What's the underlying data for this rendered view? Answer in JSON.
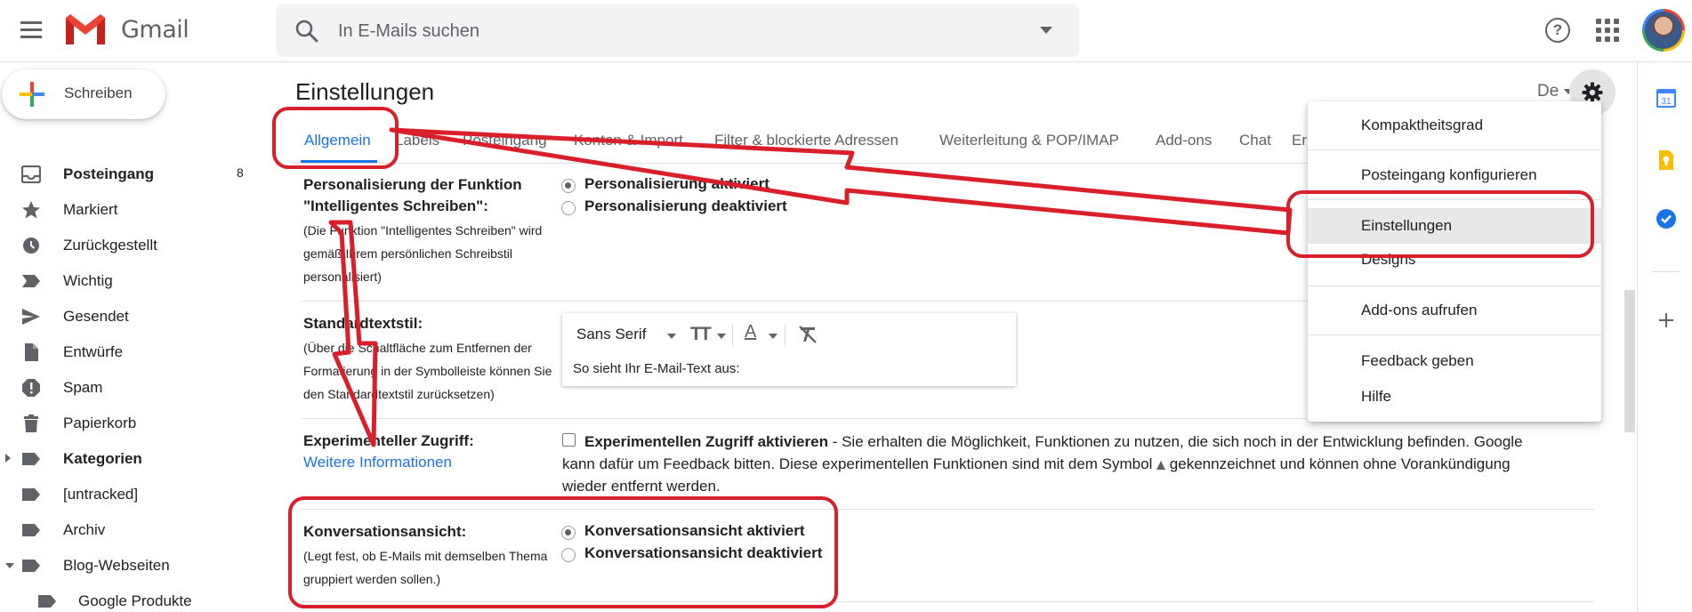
{
  "header": {
    "app_name": "Gmail",
    "search_placeholder": "In E-Mails suchen"
  },
  "sidebar": {
    "compose_label": "Schreiben",
    "items": [
      {
        "label": "Posteingang",
        "count": "8",
        "icon": "inbox-icon",
        "bold": true
      },
      {
        "label": "Markiert",
        "icon": "star-icon"
      },
      {
        "label": "Zurückgestellt",
        "icon": "clock-icon"
      },
      {
        "label": "Wichtig",
        "icon": "important-icon"
      },
      {
        "label": "Gesendet",
        "icon": "send-icon"
      },
      {
        "label": "Entwürfe",
        "icon": "draft-icon"
      },
      {
        "label": "Spam",
        "icon": "spam-icon"
      },
      {
        "label": "Papierkorb",
        "icon": "trash-icon"
      },
      {
        "label": "Kategorien",
        "icon": "label-icon",
        "bold": true
      },
      {
        "label": "[untracked]",
        "icon": "label-icon"
      },
      {
        "label": "Archiv",
        "icon": "label-icon"
      },
      {
        "label": "Blog-Webseiten",
        "icon": "label-icon"
      },
      {
        "label": "Google Produkte",
        "icon": "label-icon"
      }
    ]
  },
  "main": {
    "title": "Einstellungen",
    "lang_short": "De",
    "tabs": [
      "Allgemein",
      "Labels",
      "Posteingang",
      "Konten & Import",
      "Filter & blockierte Adressen",
      "Weiterleitung & POP/IMAP",
      "Add-ons",
      "Chat",
      "Er"
    ],
    "smart_compose": {
      "title": "Personalisierung der Funktion \"Intelligentes Schreiben\":",
      "desc": "(Die Funktion \"Intelligentes Schreiben\" wird gemäß Ihrem persönlichen Schreibstil personalisiert)",
      "option_on": "Personalisierung aktiviert",
      "option_off": "Personalisierung deaktiviert"
    },
    "text_style": {
      "title": "Standardtextstil:",
      "desc": "(Über die Schaltfläche zum Entfernen der Formatierung in der Symbolleiste können Sie den Standardtextstil zurücksetzen)",
      "font": "Sans Serif",
      "preview": "So sieht Ihr E-Mail-Text aus:"
    },
    "experimental": {
      "title": "Experimenteller Zugriff:",
      "link": "Weitere Informationen",
      "checkbox_label": "Experimentellen Zugriff aktivieren",
      "desc_1": " - Sie erhalten die Möglichkeit, Funktionen zu nutzen, die sich noch in der Entwicklung befinden. Google",
      "desc_2a": "kann dafür um Feedback bitten. Diese experimentellen Funktionen sind mit dem Symbol ",
      "desc_2b": " gekennzeichnet und können ohne Vorankündigung",
      "desc_3": "wieder entfernt werden."
    },
    "conversation": {
      "title": "Konversationsansicht:",
      "desc": "(Legt fest, ob E-Mails mit demselben Thema gruppiert werden sollen.)",
      "option_on": "Konversationsansicht aktiviert",
      "option_off": "Konversationsansicht deaktiviert"
    }
  },
  "settings_menu": {
    "items": [
      "Kompaktheitsgrad",
      "Posteingang konfigurieren",
      "Einstellungen",
      "Designs",
      "Add-ons aufrufen",
      "Feedback geben",
      "Hilfe"
    ]
  },
  "side_panel": {
    "calendar_day": "31"
  },
  "colors": {
    "accent": "#1a73e8",
    "annotation": "#d9202a"
  }
}
